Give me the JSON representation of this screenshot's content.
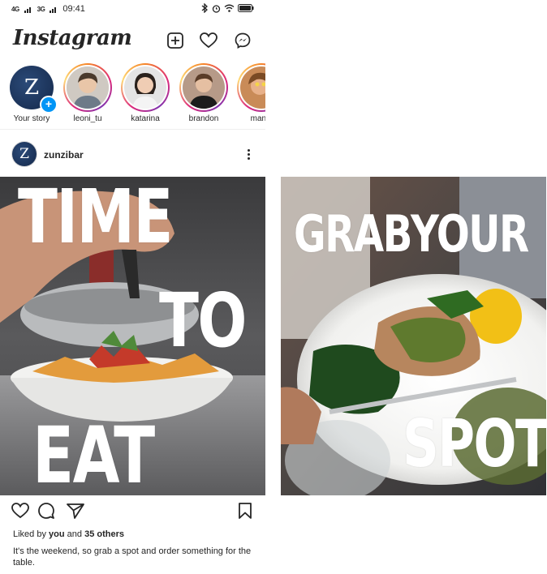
{
  "status_bar": {
    "signal_1": "4G",
    "signal_2": "3G",
    "time": "09:41"
  },
  "header": {
    "logo": "Instagram",
    "icons": [
      "new-post-icon",
      "heart-icon",
      "messenger-icon"
    ]
  },
  "stories": [
    {
      "label": "Your story",
      "initial": "Z"
    },
    {
      "label": "leoni_tu"
    },
    {
      "label": "katarina"
    },
    {
      "label": "brandon"
    },
    {
      "label": "manis"
    }
  ],
  "post": {
    "username": "zunzibar",
    "avatar_initial": "Z",
    "image_1_text": [
      "TIME",
      "TO",
      "EAT"
    ],
    "image_2_text": [
      "GRAB",
      "YOUR",
      "SPOT"
    ],
    "likes_prefix": "Liked by",
    "likes_user": "you",
    "likes_mid": "and",
    "likes_count": "35 others",
    "caption": "It's the weekend, so grab a spot and order something for the table."
  },
  "colors": {
    "accent_blue": "#0095f6",
    "text": "#262626",
    "story_ring": "#dd2a7b"
  }
}
